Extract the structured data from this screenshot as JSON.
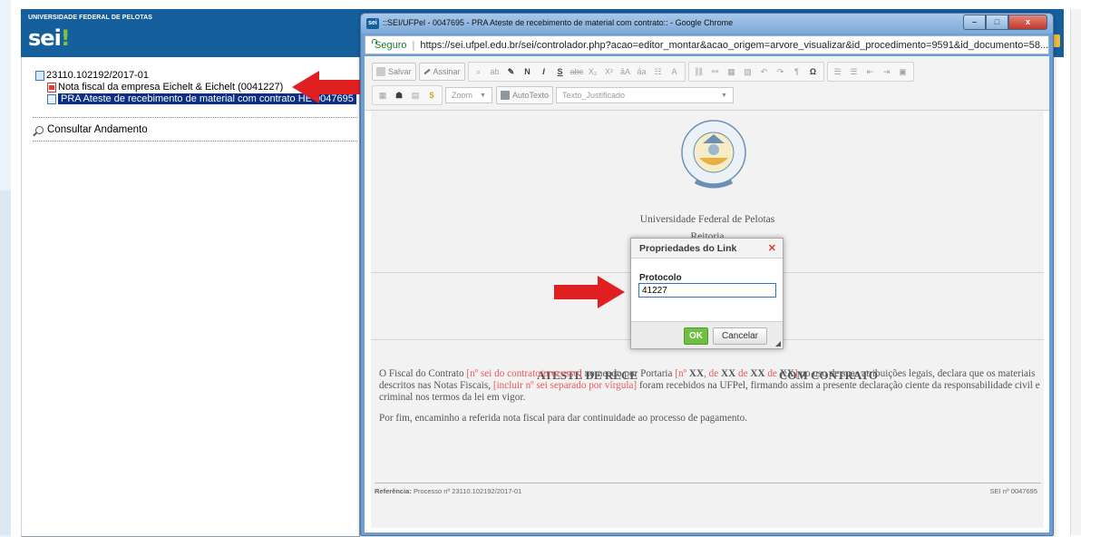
{
  "sei_app": {
    "university_title": "UNIVERSIDADE FEDERAL DE PELOTAS",
    "logo_text": "sei",
    "logo_dot": "!",
    "tree": {
      "process_number": "23110.102192/2017-01",
      "documents": [
        {
          "label": "Nota fiscal da empresa Eichelt & Eichelt (0041227)",
          "icon": "pdf-icon"
        },
        {
          "label": "PRA Ateste de recebimento de material com contrato HE 0047695",
          "icon": "document-icon"
        }
      ],
      "consultar_label": "Consultar Andamento"
    }
  },
  "browser": {
    "title": "::SEI/UFPel - 0047695 - PRA Ateste de recebimento de material com contrato:: - Google Chrome",
    "title_icon": "sei",
    "secure_label": "Seguro",
    "url": "https://sei.ufpel.edu.br/sei/controlador.php?acao=editor_montar&acao_origem=arvore_visualizar&id_procedimento=9591&id_documento=58..."
  },
  "editor": {
    "toolbar": {
      "save_label": "Salvar",
      "sign_label": "Assinar",
      "zoom_label": "Zoom",
      "autotexto_label": "AutoTexto",
      "style_label": "Texto_Justificado"
    },
    "document": {
      "university_name": "Universidade Federal de Pelotas",
      "department": "Reitoria",
      "heading_left": "ATESTE DE RECE",
      "heading_right": "COM CONTRATO",
      "paragraph1": {
        "t1": "O Fiscal do Contrato ",
        "r1": "[nº sei do contrato/processo]",
        "t2": " nomeado por Portaria ",
        "r2": "[nº ",
        "b1": "XX",
        "r3": ", de ",
        "b2": "XX",
        "r4": " de ",
        "b3": "XX",
        "r5": " de ",
        "b4": "XX",
        "r6": "]",
        "t3": " no uso de suas atribuições legais, declara que os materiais descritos nas Notas Fiscais, ",
        "r7": "[incluir nº sei separado por vírgula]",
        "t4": " foram recebidos na UFPel, firmando  assim a presente declaração ciente da responsabilidade civil e criminal nos termos da lei em vigor."
      },
      "paragraph2": "Por fim, encaminho a referida nota fiscal para dar continuidade ao processo de pagamento.",
      "reference_label": "Referência:",
      "reference_value": " Processo nº 23110.102192/2017-01",
      "sei_number": "SEI nº 0047695"
    }
  },
  "dialog": {
    "title": "Propriedades do Link",
    "field_label": "Protocolo",
    "field_value": "41227",
    "ok_label": "OK",
    "cancel_label": "Cancelar"
  },
  "colors": {
    "sei_header": "#155f9d",
    "selected_item": "#0b2f86",
    "arrow": "#e02020",
    "ok_button": "#6fbf42"
  }
}
